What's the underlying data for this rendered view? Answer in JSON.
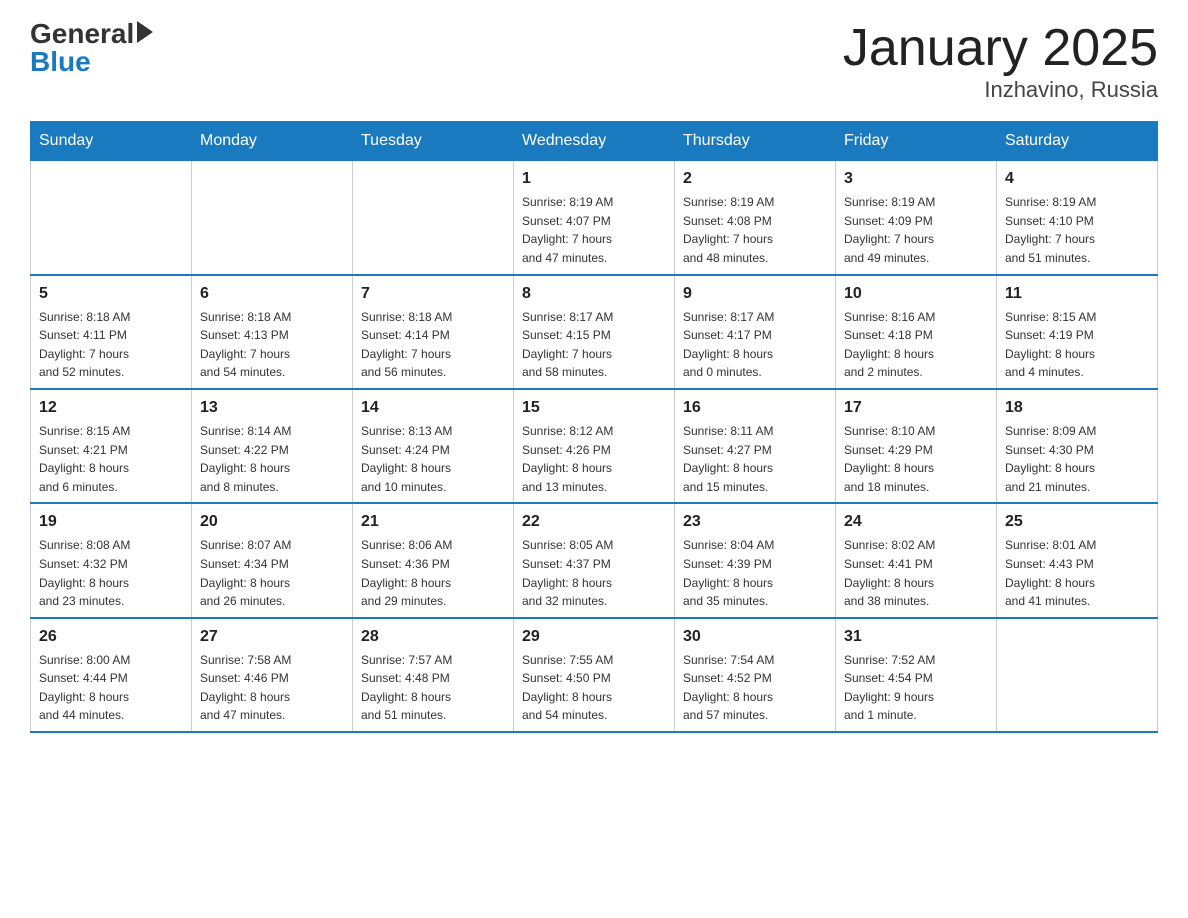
{
  "logo": {
    "general": "General",
    "blue": "Blue"
  },
  "title": "January 2025",
  "location": "Inzhavino, Russia",
  "days_of_week": [
    "Sunday",
    "Monday",
    "Tuesday",
    "Wednesday",
    "Thursday",
    "Friday",
    "Saturday"
  ],
  "weeks": [
    [
      {
        "day": "",
        "info": ""
      },
      {
        "day": "",
        "info": ""
      },
      {
        "day": "",
        "info": ""
      },
      {
        "day": "1",
        "info": "Sunrise: 8:19 AM\nSunset: 4:07 PM\nDaylight: 7 hours\nand 47 minutes."
      },
      {
        "day": "2",
        "info": "Sunrise: 8:19 AM\nSunset: 4:08 PM\nDaylight: 7 hours\nand 48 minutes."
      },
      {
        "day": "3",
        "info": "Sunrise: 8:19 AM\nSunset: 4:09 PM\nDaylight: 7 hours\nand 49 minutes."
      },
      {
        "day": "4",
        "info": "Sunrise: 8:19 AM\nSunset: 4:10 PM\nDaylight: 7 hours\nand 51 minutes."
      }
    ],
    [
      {
        "day": "5",
        "info": "Sunrise: 8:18 AM\nSunset: 4:11 PM\nDaylight: 7 hours\nand 52 minutes."
      },
      {
        "day": "6",
        "info": "Sunrise: 8:18 AM\nSunset: 4:13 PM\nDaylight: 7 hours\nand 54 minutes."
      },
      {
        "day": "7",
        "info": "Sunrise: 8:18 AM\nSunset: 4:14 PM\nDaylight: 7 hours\nand 56 minutes."
      },
      {
        "day": "8",
        "info": "Sunrise: 8:17 AM\nSunset: 4:15 PM\nDaylight: 7 hours\nand 58 minutes."
      },
      {
        "day": "9",
        "info": "Sunrise: 8:17 AM\nSunset: 4:17 PM\nDaylight: 8 hours\nand 0 minutes."
      },
      {
        "day": "10",
        "info": "Sunrise: 8:16 AM\nSunset: 4:18 PM\nDaylight: 8 hours\nand 2 minutes."
      },
      {
        "day": "11",
        "info": "Sunrise: 8:15 AM\nSunset: 4:19 PM\nDaylight: 8 hours\nand 4 minutes."
      }
    ],
    [
      {
        "day": "12",
        "info": "Sunrise: 8:15 AM\nSunset: 4:21 PM\nDaylight: 8 hours\nand 6 minutes."
      },
      {
        "day": "13",
        "info": "Sunrise: 8:14 AM\nSunset: 4:22 PM\nDaylight: 8 hours\nand 8 minutes."
      },
      {
        "day": "14",
        "info": "Sunrise: 8:13 AM\nSunset: 4:24 PM\nDaylight: 8 hours\nand 10 minutes."
      },
      {
        "day": "15",
        "info": "Sunrise: 8:12 AM\nSunset: 4:26 PM\nDaylight: 8 hours\nand 13 minutes."
      },
      {
        "day": "16",
        "info": "Sunrise: 8:11 AM\nSunset: 4:27 PM\nDaylight: 8 hours\nand 15 minutes."
      },
      {
        "day": "17",
        "info": "Sunrise: 8:10 AM\nSunset: 4:29 PM\nDaylight: 8 hours\nand 18 minutes."
      },
      {
        "day": "18",
        "info": "Sunrise: 8:09 AM\nSunset: 4:30 PM\nDaylight: 8 hours\nand 21 minutes."
      }
    ],
    [
      {
        "day": "19",
        "info": "Sunrise: 8:08 AM\nSunset: 4:32 PM\nDaylight: 8 hours\nand 23 minutes."
      },
      {
        "day": "20",
        "info": "Sunrise: 8:07 AM\nSunset: 4:34 PM\nDaylight: 8 hours\nand 26 minutes."
      },
      {
        "day": "21",
        "info": "Sunrise: 8:06 AM\nSunset: 4:36 PM\nDaylight: 8 hours\nand 29 minutes."
      },
      {
        "day": "22",
        "info": "Sunrise: 8:05 AM\nSunset: 4:37 PM\nDaylight: 8 hours\nand 32 minutes."
      },
      {
        "day": "23",
        "info": "Sunrise: 8:04 AM\nSunset: 4:39 PM\nDaylight: 8 hours\nand 35 minutes."
      },
      {
        "day": "24",
        "info": "Sunrise: 8:02 AM\nSunset: 4:41 PM\nDaylight: 8 hours\nand 38 minutes."
      },
      {
        "day": "25",
        "info": "Sunrise: 8:01 AM\nSunset: 4:43 PM\nDaylight: 8 hours\nand 41 minutes."
      }
    ],
    [
      {
        "day": "26",
        "info": "Sunrise: 8:00 AM\nSunset: 4:44 PM\nDaylight: 8 hours\nand 44 minutes."
      },
      {
        "day": "27",
        "info": "Sunrise: 7:58 AM\nSunset: 4:46 PM\nDaylight: 8 hours\nand 47 minutes."
      },
      {
        "day": "28",
        "info": "Sunrise: 7:57 AM\nSunset: 4:48 PM\nDaylight: 8 hours\nand 51 minutes."
      },
      {
        "day": "29",
        "info": "Sunrise: 7:55 AM\nSunset: 4:50 PM\nDaylight: 8 hours\nand 54 minutes."
      },
      {
        "day": "30",
        "info": "Sunrise: 7:54 AM\nSunset: 4:52 PM\nDaylight: 8 hours\nand 57 minutes."
      },
      {
        "day": "31",
        "info": "Sunrise: 7:52 AM\nSunset: 4:54 PM\nDaylight: 9 hours\nand 1 minute."
      },
      {
        "day": "",
        "info": ""
      }
    ]
  ]
}
